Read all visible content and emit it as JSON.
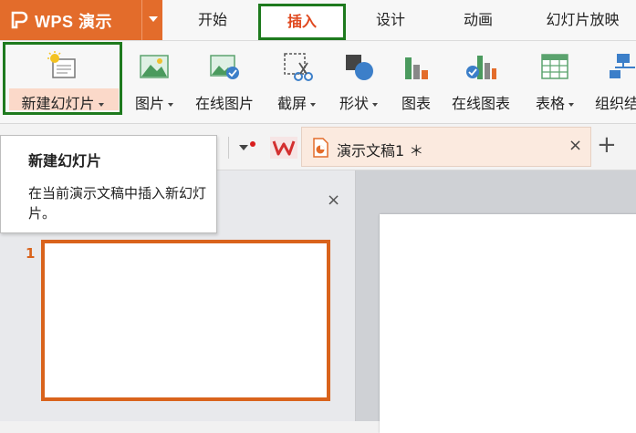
{
  "app": {
    "name": "WPS 演示"
  },
  "menu": {
    "tabs": [
      {
        "label": "开始"
      },
      {
        "label": "插入"
      },
      {
        "label": "设计"
      },
      {
        "label": "动画"
      },
      {
        "label": "幻灯片放映"
      }
    ],
    "active_tab": "插入"
  },
  "ribbon": {
    "buttons": [
      {
        "label": "新建幻灯片",
        "icon": "new-slide-icon"
      },
      {
        "label": "图片",
        "icon": "picture-icon"
      },
      {
        "label": "在线图片",
        "icon": "online-picture-icon"
      },
      {
        "label": "截屏",
        "icon": "screenshot-icon"
      },
      {
        "label": "形状",
        "icon": "shapes-icon"
      },
      {
        "label": "图表",
        "icon": "chart-icon"
      },
      {
        "label": "在线图表",
        "icon": "online-chart-icon"
      },
      {
        "label": "表格",
        "icon": "table-icon"
      },
      {
        "label": "组织结",
        "icon": "org-chart-icon"
      }
    ]
  },
  "document_tab": {
    "title": "演示文稿1 ＊",
    "close": "×",
    "add": "+"
  },
  "tooltip": {
    "title": "新建幻灯片",
    "description": "在当前演示文稿中插入新幻灯片。"
  },
  "slides_pane": {
    "close": "×",
    "slide_number": "1"
  },
  "colors": {
    "accent": "#e36c2b",
    "highlight": "#1e7a1e",
    "active_tab_text": "#e0491f"
  }
}
